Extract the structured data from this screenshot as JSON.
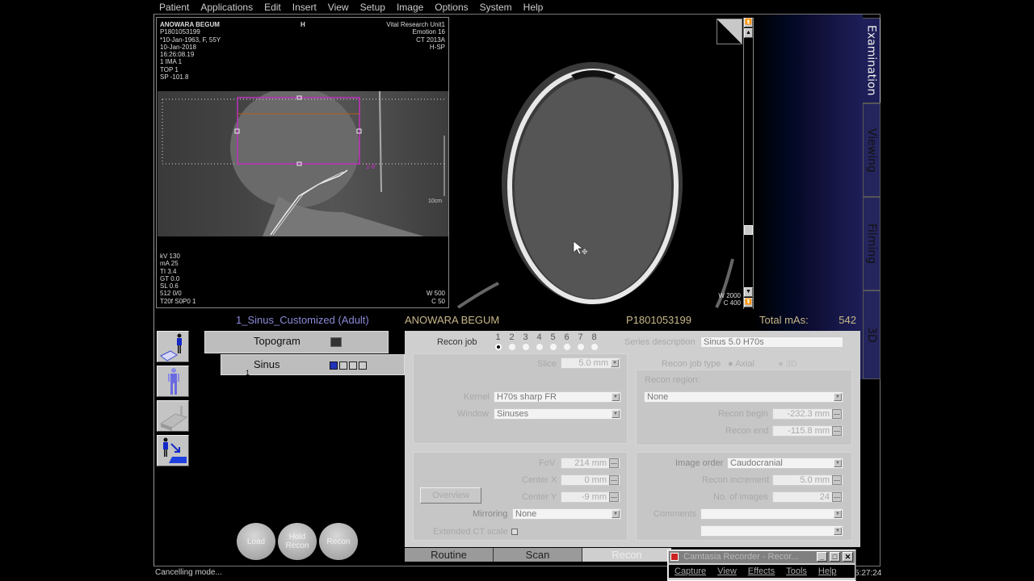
{
  "menubar": [
    "Patient",
    "Applications",
    "Edit",
    "Insert",
    "View",
    "Setup",
    "Image",
    "Options",
    "System",
    "Help"
  ],
  "topogram": {
    "top_left": [
      "ANOWARA BEGUM",
      "P1801053199",
      "*10-Jan-1963, F, 55Y",
      "10-Jan-2018",
      "16:26:08.19",
      "1 IMA 1",
      "TOP 1",
      "SP -101.8"
    ],
    "top_center": "H",
    "top_right": [
      "Vital Research Unit1",
      "Emotion 16",
      "CT 2013A",
      "H-SP"
    ],
    "bottom_left": [
      "kV 130",
      "mA 25",
      "TI 3.4",
      "GT 0.0",
      "SL 0.6",
      "512 0/0",
      "T20f S0P0  1"
    ],
    "bottom_right": [
      "W    500",
      "C      50"
    ],
    "scale_label": "10cm",
    "range_label": "1-8"
  },
  "axial": {
    "window_center": [
      "W  2000",
      "C    400"
    ]
  },
  "right_tabs": [
    "Examination",
    "Viewing",
    "Filming",
    "3D"
  ],
  "info": {
    "protocol": "1_Sinus_Customized (Adult)",
    "patient_name": "ANOWARA BEGUM",
    "patient_id": "P1801053199",
    "total_mas_label": "Total mAs:",
    "total_mas_value": "542"
  },
  "left_icons": [
    "patient-position-icon",
    "patient-model-icon",
    "table-icon",
    "patient-transfer-icon"
  ],
  "scan_list": [
    {
      "label": "Topogram",
      "number": ""
    },
    {
      "label": "Sinus",
      "number": "1"
    }
  ],
  "round_buttons": [
    "Load",
    "Hold Recon",
    "Recon"
  ],
  "recon": {
    "recon_job_label": "Recon job",
    "recon_jobs": [
      "1",
      "2",
      "3",
      "4",
      "5",
      "6",
      "7",
      "8"
    ],
    "selected_job": "1",
    "series_description_label": "Series description",
    "series_description": "Sinus  5.0  H70s",
    "slice_label": "Slice",
    "slice": "5.0 mm",
    "recon_job_type_label": "Recon job type",
    "recon_job_type_options": [
      "Axial",
      "3D"
    ],
    "recon_job_type_selected": "Axial",
    "recon_region_label": "Recon region:",
    "recon_region": "None",
    "kernel_label": "Kernel",
    "kernel": "H70s sharp FR",
    "window_label": "Window",
    "window": "Sinuses",
    "recon_begin_label": "Recon begin",
    "recon_begin": "-232.3 mm",
    "recon_end_label": "Recon end",
    "recon_end": "-115.8 mm",
    "fov_label": "FoV",
    "fov": "214 mm",
    "center_x_label": "Center X",
    "center_x": "0 mm",
    "center_y_label": "Center Y",
    "center_y": "-9 mm",
    "overview_button": "Overview",
    "mirroring_label": "Mirroring",
    "mirroring": "None",
    "extended_ct_label": "Extended CT scale",
    "image_order_label": "Image order",
    "image_order": "Caudocranial",
    "recon_increment_label": "Recon increment",
    "recon_increment": "5.0 mm",
    "num_images_label": "No. of images",
    "num_images": "24",
    "comments_label": "Comments",
    "comments": "",
    "comments2": ""
  },
  "bottom_tabs": [
    "Routine",
    "Scan",
    "Recon"
  ],
  "active_bottom_tab": "Recon",
  "status": "Cancelling mode...",
  "clock": "5:27:24",
  "camtasia": {
    "title": "Camtasia Recorder - Recor...",
    "menu": [
      "Capture",
      "View",
      "Effects",
      "Tools",
      "Help"
    ]
  }
}
